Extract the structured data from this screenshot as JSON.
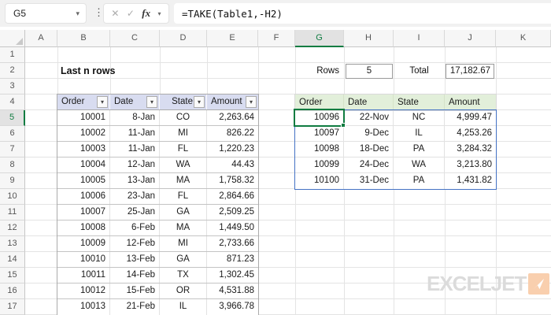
{
  "formula_bar": {
    "cell_ref": "G5",
    "formula": "=TAKE(Table1,-H2)"
  },
  "icons": {
    "chevron_down": "▾",
    "close": "✕",
    "check": "✓",
    "fx": "fx",
    "dots": "⋮",
    "filter_arrow": "▾"
  },
  "grid": {
    "column_letters": [
      "A",
      "B",
      "C",
      "D",
      "E",
      "F",
      "G",
      "H",
      "I",
      "J",
      "K"
    ],
    "selected_column": "G",
    "row_numbers": [
      1,
      2,
      3,
      4,
      5,
      6,
      7,
      8,
      9,
      10,
      11,
      12,
      13,
      14,
      15,
      16,
      17
    ],
    "selected_row": 5
  },
  "sheet": {
    "title": "Last n rows",
    "source_table": {
      "headers": [
        "Order",
        "Date",
        "State",
        "Amount"
      ],
      "rows": [
        [
          "10001",
          "8-Jan",
          "CO",
          "2,263.64"
        ],
        [
          "10002",
          "11-Jan",
          "MI",
          "826.22"
        ],
        [
          "10003",
          "11-Jan",
          "FL",
          "1,220.23"
        ],
        [
          "10004",
          "12-Jan",
          "WA",
          "44.43"
        ],
        [
          "10005",
          "13-Jan",
          "MA",
          "1,758.32"
        ],
        [
          "10006",
          "23-Jan",
          "FL",
          "2,864.66"
        ],
        [
          "10007",
          "25-Jan",
          "GA",
          "2,509.25"
        ],
        [
          "10008",
          "6-Feb",
          "MA",
          "1,449.50"
        ],
        [
          "10009",
          "12-Feb",
          "MI",
          "2,733.66"
        ],
        [
          "10010",
          "13-Feb",
          "GA",
          "871.23"
        ],
        [
          "10011",
          "14-Feb",
          "TX",
          "1,302.45"
        ],
        [
          "10012",
          "15-Feb",
          "OR",
          "4,531.88"
        ],
        [
          "10013",
          "21-Feb",
          "IL",
          "3,966.78"
        ]
      ]
    },
    "controls": {
      "rows_label": "Rows",
      "rows_value": "5",
      "total_label": "Total",
      "total_value": "17,182.67"
    },
    "result_table": {
      "headers": [
        "Order",
        "Date",
        "State",
        "Amount"
      ],
      "rows": [
        [
          "10096",
          "22-Nov",
          "NC",
          "4,999.47"
        ],
        [
          "10097",
          "9-Dec",
          "IL",
          "4,253.26"
        ],
        [
          "10098",
          "18-Dec",
          "PA",
          "3,284.32"
        ],
        [
          "10099",
          "24-Dec",
          "WA",
          "3,213.80"
        ],
        [
          "10100",
          "31-Dec",
          "PA",
          "1,431.82"
        ]
      ],
      "selected_cell": "G5"
    },
    "logo": {
      "text": "EXCELJET"
    }
  },
  "colors": {
    "accent_green": "#107C41",
    "spill_blue": "#4472C4",
    "source_header_fill": "#D8DCF0",
    "result_header_fill": "#E2EFDA",
    "logo_orange": "#F9CFAE"
  }
}
